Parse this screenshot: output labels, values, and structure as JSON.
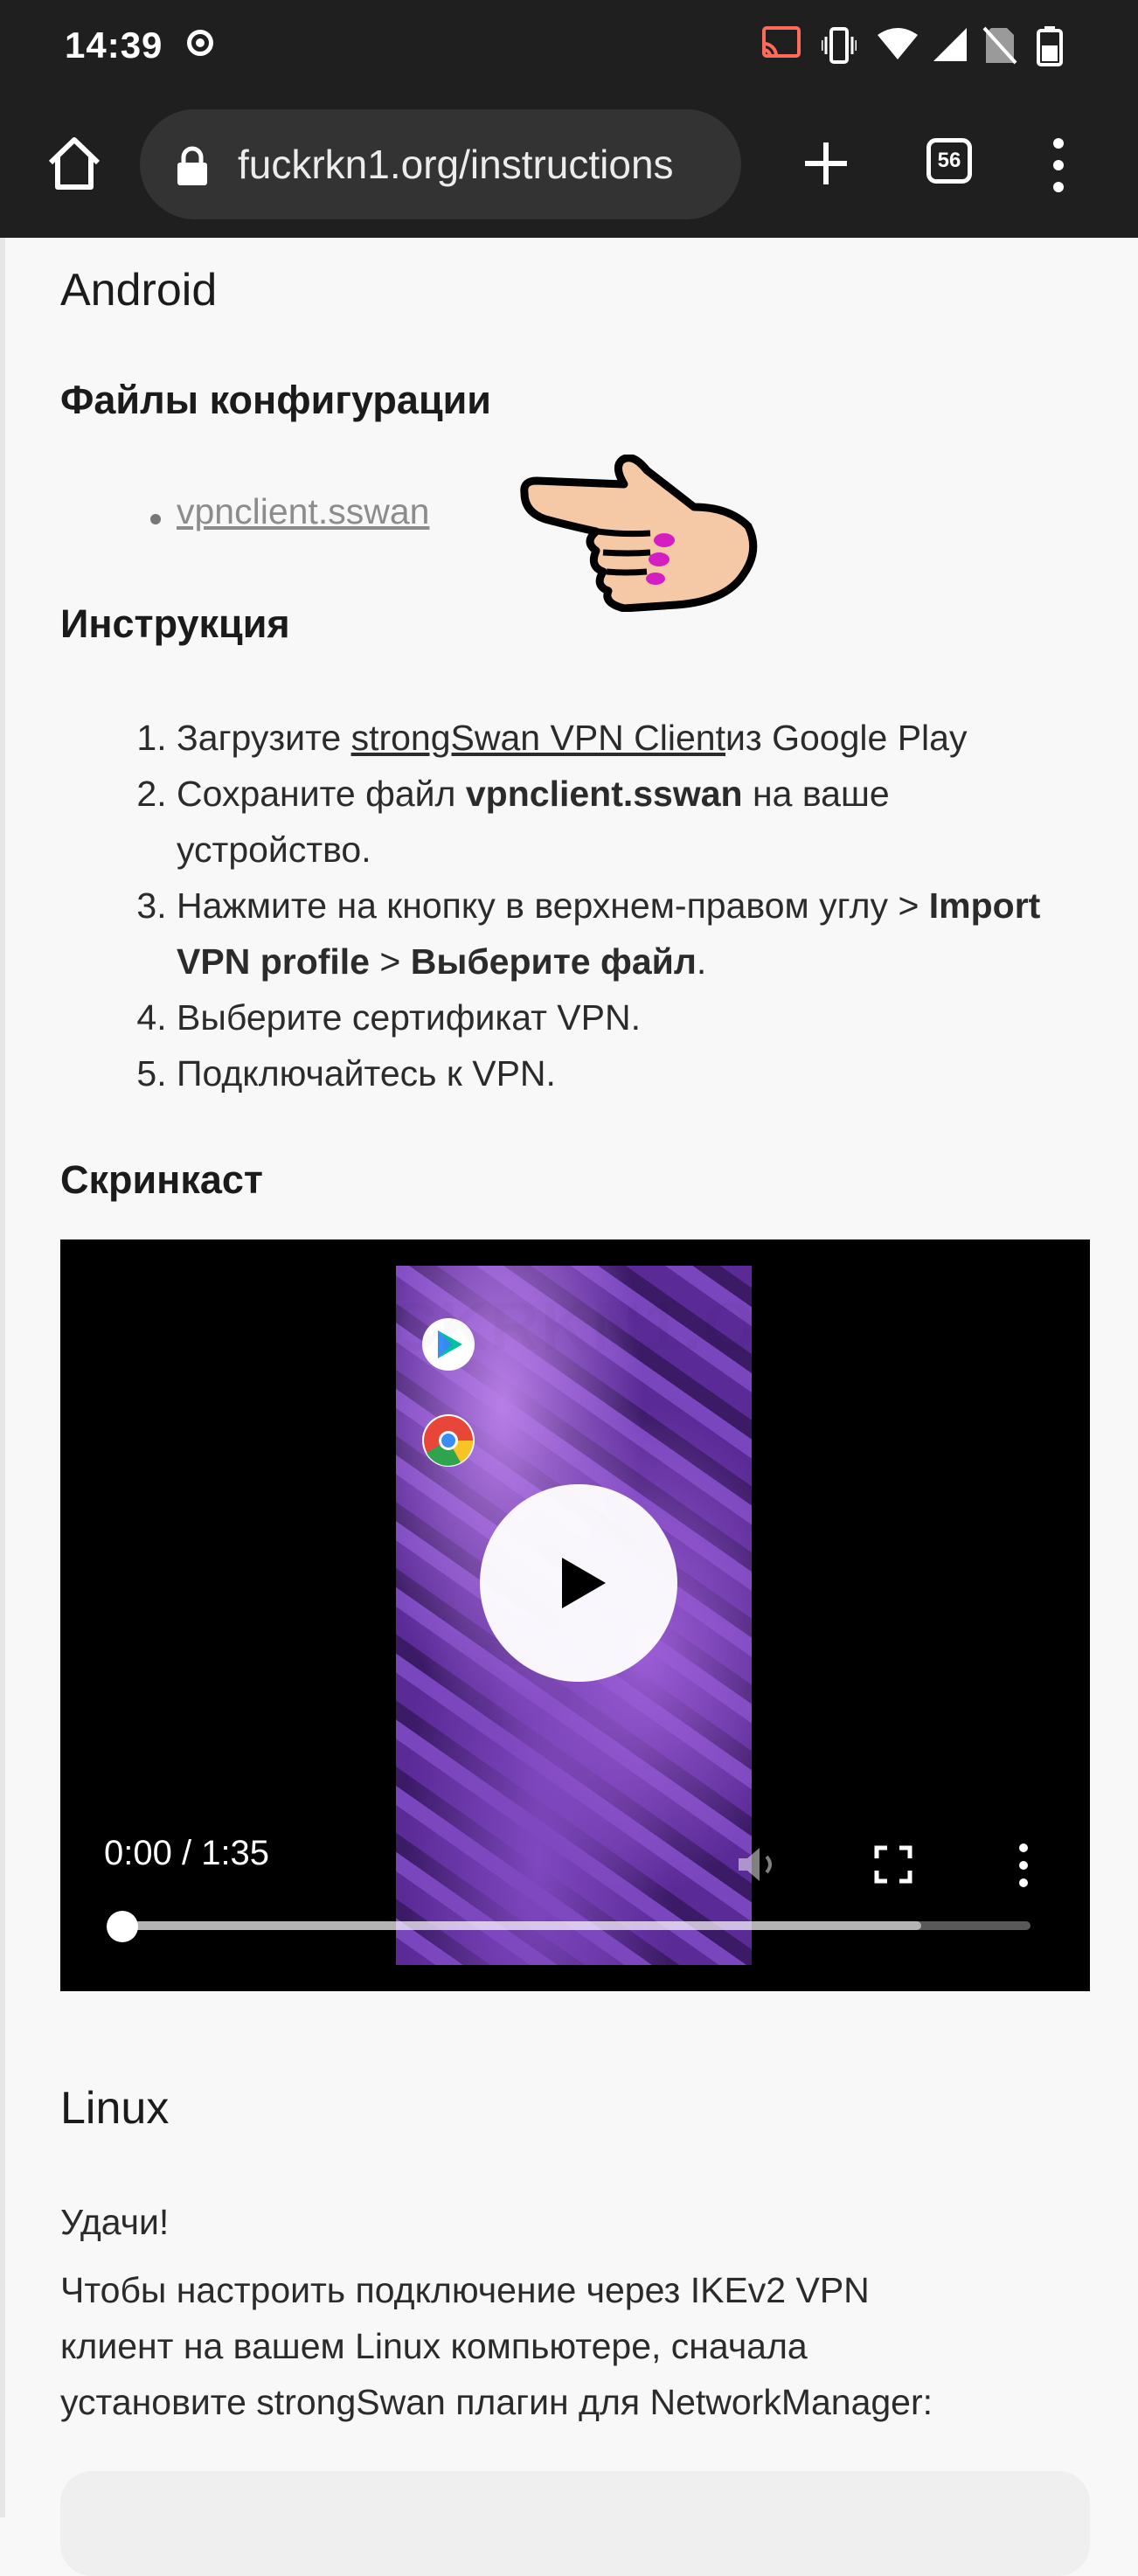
{
  "status_bar": {
    "time": "14:39",
    "icons": [
      "record-icon",
      "cast-icon",
      "vibrate-icon",
      "wifi-icon",
      "signal-icon",
      "no-sim-icon",
      "battery-icon"
    ]
  },
  "browser": {
    "url": "fuckrkn1.org/instructions",
    "tab_count": "56"
  },
  "page": {
    "android_heading": "Android",
    "config_heading": "Файлы конфигурации",
    "config_file_link": "vpnclient.sswan",
    "instruction_heading": "Инструкция",
    "steps": {
      "s1_pre": "Загрузите ",
      "s1_link": "strongSwan VPN Client",
      "s1_post": "из Google Play",
      "s2_pre": "Сохраните файл ",
      "s2_bold": "vpnclient.sswan",
      "s2_post": " на ваше устройство.",
      "s3_pre": "Нажмите на кнопку в верхнем-правом углу > ",
      "s3_bold1": "Import VPN profile",
      "s3_mid": " > ",
      "s3_bold2": "Выберите файл",
      "s3_post": ".",
      "s4": "Выберите сертификат VPN.",
      "s5": "Подключайтесь к VPN."
    },
    "screencast_heading": "Скринкаст",
    "video": {
      "time": "0:00 / 1:35",
      "progress_fraction": 0.0,
      "inner_app_labels": [
        "Google Play",
        "Chrome"
      ]
    },
    "linux_heading": "Linux",
    "linux_greeting": "Удачи!",
    "linux_paragraph_line1": "Чтобы настроить подключение через IKEv2 VPN",
    "linux_paragraph_line2": "клиент на вашем Linux компьютере, сначала",
    "linux_paragraph_line3": "установите strongSwan плагин для NetworkManager:",
    "watermark": "FUCKRKN1.ORG"
  },
  "colors": {
    "chrome_dark": "#1f1f1f",
    "urlbar": "#333333",
    "page_bg": "#f8f8f8",
    "text": "#2b2b2b",
    "muted_link": "#8c8c8c",
    "annotation_nail": "#d41ec1",
    "annotation_skin": "#f5c8a6"
  }
}
